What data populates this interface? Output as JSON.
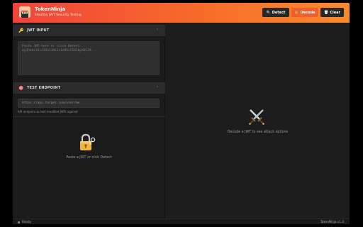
{
  "header": {
    "title": "TokenNinja",
    "subtitle": "Stealthy JWT Security Testing",
    "buttons": {
      "detect": {
        "icon": "🔍",
        "label": "Detect"
      },
      "decode": {
        "icon": "🔓",
        "label": "Decode"
      },
      "clear": {
        "icon": "🗑",
        "label": "Clear"
      }
    }
  },
  "jwt_section": {
    "icon": "🔑",
    "title": "JWT INPUT",
    "chevron": "⌃",
    "placeholder": "Paste JWT here or click Detect...\neyJhbGciOiJIUzI1NiIsInR5cCI6IkpXVCJ9..."
  },
  "endpoint_section": {
    "icon": "🎯",
    "title": "TEST ENDPOINT",
    "chevron": "⌃",
    "placeholder": "https://api.target.com/user/me",
    "hint": "API endpoint to test modified JWTs against"
  },
  "left_empty": {
    "icon": "lock-with-key-icon",
    "text": "Paste a JWT or click Detect"
  },
  "right_empty": {
    "icon": "crossed-swords-icon",
    "text": "Decode a JWT to see attack options"
  },
  "status": {
    "text": "Ready",
    "version": "TokenNinja v1.0"
  },
  "colors": {
    "accent": "#f25d2d",
    "header_start": "#f0443c",
    "header_end": "#f98a2e",
    "background": "#1d1d1d"
  }
}
